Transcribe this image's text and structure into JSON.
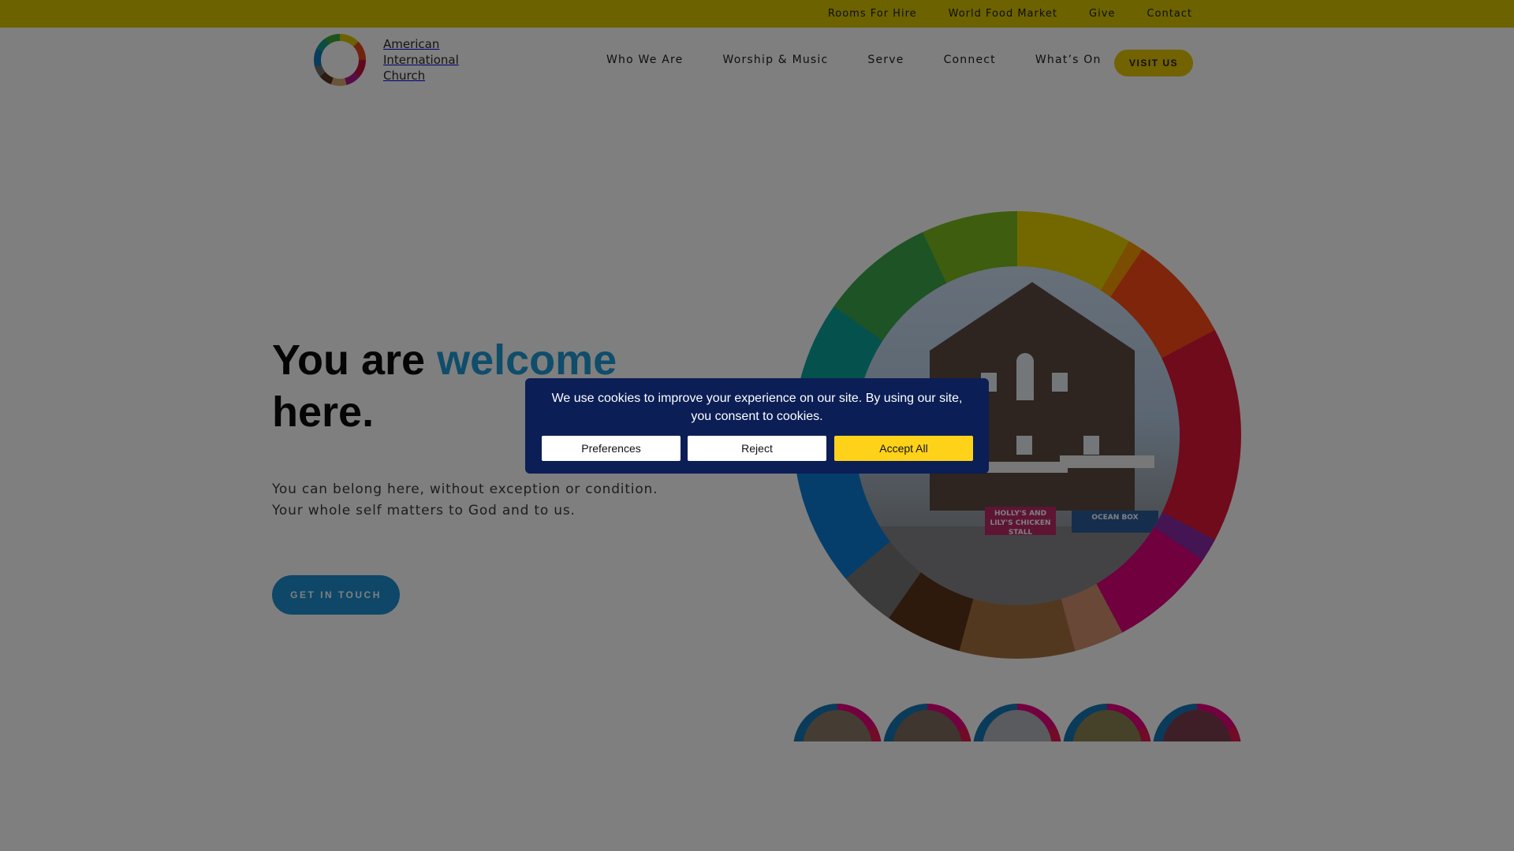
{
  "topbar": {
    "links": [
      "Rooms For Hire",
      "World Food Market",
      "Give",
      "Contact"
    ]
  },
  "header": {
    "logo_text": "American International Church",
    "nav": [
      "Who We Are",
      "Worship & Music",
      "Serve",
      "Connect",
      "What’s On"
    ],
    "visit_button": "VISIT US"
  },
  "hero": {
    "title_prefix": "You are ",
    "title_accent": "welcome",
    "title_suffix": "here.",
    "subtitle_line1": "You can belong here, without exception or condition.",
    "subtitle_line2": "Your whole self matters to God and to us.",
    "cta": "GET IN TOUCH",
    "photo_sign_text": "HOLLY'S AND LILY'S CHICKEN STALL",
    "photo_banner_text": "OCEAN BOX"
  },
  "cookie_banner": {
    "message": "We use cookies to improve your experience on our site. By using our site, you consent to cookies.",
    "preferences": "Preferences",
    "reject": "Reject",
    "accept": "Accept All"
  },
  "colors": {
    "topbar": "#d8c400",
    "visit_button": "#e5c400",
    "accent_blue": "#1f9bd6",
    "cta_blue": "#1c8fd0",
    "cookie_bg": "#0b1e56",
    "accept_yellow": "#ffd21a"
  }
}
